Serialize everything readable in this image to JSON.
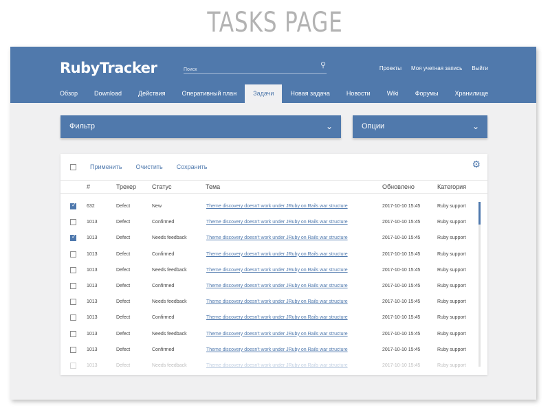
{
  "page_title": "TASKS PAGE",
  "header": {
    "logo": "RubyTracker",
    "search_placeholder": "Поиск",
    "links": [
      "Проекты",
      "Моя учетная запись",
      "Выйти"
    ]
  },
  "nav": [
    "Обзор",
    "Download",
    "Действия",
    "Оперативный план",
    "Задачи",
    "Новая задача",
    "Новости",
    "Wiki",
    "Форумы",
    "Хранилище"
  ],
  "nav_active": "Задачи",
  "filter": {
    "label": "Фильтр"
  },
  "options": {
    "label": "Опции"
  },
  "toolbar": {
    "apply": "Применить",
    "clear": "Очистить",
    "save": "Сохранить"
  },
  "columns": [
    "#",
    "Трекер",
    "Статус",
    "Тема",
    "Обновлено",
    "Категория"
  ],
  "rows": [
    {
      "checked": true,
      "id": "632",
      "tracker": "Defect",
      "status": "New",
      "subject": "Theme discovery doesn't work under JRuby on Rails war structure",
      "updated": "2017-10-10 15:45",
      "category": "Ruby support"
    },
    {
      "checked": false,
      "id": "1013",
      "tracker": "Defect",
      "status": "Confirmed",
      "subject": "Theme discovery doesn't work under JRuby on Rails war structure",
      "updated": "2017-10-10 15:45",
      "category": "Ruby support"
    },
    {
      "checked": true,
      "id": "1013",
      "tracker": "Defect",
      "status": "Needs feedback",
      "subject": "Theme discovery doesn't work under JRuby on Rails war structure",
      "updated": "2017-10-10 15:45",
      "category": "Ruby support"
    },
    {
      "checked": false,
      "id": "1013",
      "tracker": "Defect",
      "status": "Confirmed",
      "subject": "Theme discovery doesn't work under JRuby on Rails war structure",
      "updated": "2017-10-10 15:45",
      "category": "Ruby support"
    },
    {
      "checked": false,
      "id": "1013",
      "tracker": "Defect",
      "status": "Needs feedback",
      "subject": "Theme discovery doesn't work under JRuby on Rails war structure",
      "updated": "2017-10-10 15:45",
      "category": "Ruby support"
    },
    {
      "checked": false,
      "id": "1013",
      "tracker": "Defect",
      "status": "Confirmed",
      "subject": "Theme discovery doesn't work under JRuby on Rails war structure",
      "updated": "2017-10-10 15:45",
      "category": "Ruby support"
    },
    {
      "checked": false,
      "id": "1013",
      "tracker": "Defect",
      "status": "Needs feedback",
      "subject": "Theme discovery doesn't work under JRuby on Rails war structure",
      "updated": "2017-10-10 15:45",
      "category": "Ruby support"
    },
    {
      "checked": false,
      "id": "1013",
      "tracker": "Defect",
      "status": "Confirmed",
      "subject": "Theme discovery doesn't work under JRuby on Rails war structure",
      "updated": "2017-10-10 15:45",
      "category": "Ruby support"
    },
    {
      "checked": false,
      "id": "1013",
      "tracker": "Defect",
      "status": "Needs feedback",
      "subject": "Theme discovery doesn't work under JRuby on Rails war structure",
      "updated": "2017-10-10 15:45",
      "category": "Ruby support"
    },
    {
      "checked": false,
      "id": "1013",
      "tracker": "Defect",
      "status": "Confirmed",
      "subject": "Theme discovery doesn't work under JRuby on Rails war structure",
      "updated": "2017-10-10 15:45",
      "category": "Ruby support"
    },
    {
      "checked": false,
      "id": "1013",
      "tracker": "Defect",
      "status": "Needs feedback",
      "subject": "Theme discovery doesn't work under JRuby on Rails war structure",
      "updated": "2017-10-10 15:45",
      "category": "Ruby support"
    }
  ],
  "scroll_position": 0
}
